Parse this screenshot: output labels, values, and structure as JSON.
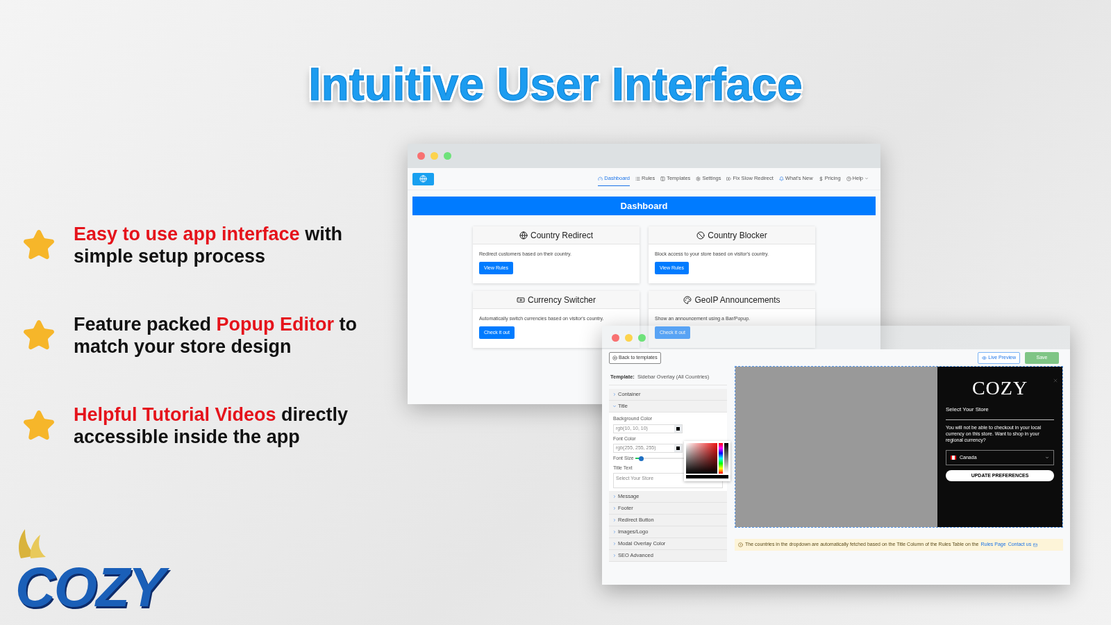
{
  "headline": "Intuitive User Interface",
  "features": [
    {
      "parts": [
        {
          "text": "Easy to use app interface",
          "highlight": true
        },
        {
          "text": " with simple setup process",
          "highlight": false
        }
      ]
    },
    {
      "parts": [
        {
          "text": "Feature packed ",
          "highlight": false
        },
        {
          "text": "Popup Editor",
          "highlight": true
        },
        {
          "text": " to match your store design",
          "highlight": false
        }
      ]
    },
    {
      "parts": [
        {
          "text": "Helpful Tutorial Videos",
          "highlight": true
        },
        {
          "text": " directly accessible inside the app",
          "highlight": false
        }
      ]
    }
  ],
  "brand_logo": "COZY",
  "dashboard_window": {
    "nav": [
      {
        "label": "Dashboard",
        "selected": true
      },
      {
        "label": "Rules",
        "selected": false
      },
      {
        "label": "Templates",
        "selected": false
      },
      {
        "label": "Settings",
        "selected": false
      },
      {
        "label": "Fix Slow Redirect",
        "selected": false
      },
      {
        "label": "What's New",
        "selected": false
      },
      {
        "label": "Pricing",
        "selected": false
      },
      {
        "label": "Help",
        "selected": false,
        "dropdown": true
      }
    ],
    "banner": "Dashboard",
    "cards": [
      {
        "title": "Country Redirect",
        "description": "Redirect customers based on their country.",
        "button": "View Rules"
      },
      {
        "title": "Country Blocker",
        "description": "Block access to your store based on visitor's country.",
        "button": "View Rules"
      },
      {
        "title": "Currency Switcher",
        "description": "Automatically switch currencies based on visitor's country.",
        "button": "Check it out"
      },
      {
        "title": "GeoIP Announcements",
        "description": "Show an announcement using a Bar/Popup.",
        "button": "Check it out"
      }
    ]
  },
  "editor_window": {
    "back_button": "Back to templates",
    "live_preview": "Live Preview",
    "save": "Save",
    "template_label": "Template:",
    "template_name": "Sidebar Overlay (All Countries)",
    "sections": [
      {
        "title": "Container",
        "expanded": false
      },
      {
        "title": "Title",
        "expanded": true,
        "fields": [
          {
            "kind": "color",
            "label": "Background Color",
            "value": "rgb(10, 10, 10)"
          },
          {
            "kind": "color",
            "label": "Font Color",
            "value": "rgb(255, 255, 255)"
          },
          {
            "kind": "slider",
            "label": "Font Size",
            "level": 0.1
          },
          {
            "kind": "textarea",
            "label": "Title Text",
            "value": "Select Your Store"
          }
        ]
      },
      {
        "title": "Message",
        "expanded": false
      },
      {
        "title": "Footer",
        "expanded": false
      },
      {
        "title": "Redirect Button",
        "expanded": false
      },
      {
        "title": "Images/Logo",
        "expanded": false
      },
      {
        "title": "Modal Overlay Color",
        "expanded": false
      },
      {
        "title": "SEO Advanced",
        "expanded": false
      }
    ],
    "preview": {
      "logo": "COZY",
      "heading": "Select Your Store",
      "message": "You will not be able to checkout in your local currency on this store. Want to shop in your regional currency?",
      "country": "Canada",
      "button": "UPDATE PREFERENCES"
    },
    "notice": {
      "text": "The countries in the dropdown are automatically fetched based on the Title Column of the Rules Table on the",
      "link": "Rules Page",
      "contact": "Contact us"
    }
  }
}
